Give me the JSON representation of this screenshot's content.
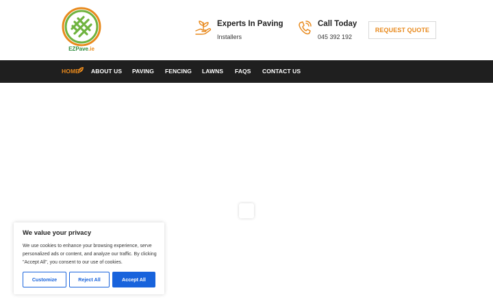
{
  "brand": {
    "name": "EZPave",
    "suffix": ".ie",
    "accent": "#e8891c",
    "green": "#2a8a3a"
  },
  "header": {
    "experts_title": "Experts In Paving",
    "experts_sub": "Installers",
    "call_title": "Call Today",
    "call_phone": "045 392 192",
    "quote_label": "REQUEST QUOTE"
  },
  "nav": {
    "items": [
      {
        "label": "HOME",
        "active": true
      },
      {
        "label": "ABOUT US"
      },
      {
        "label": "PAVING"
      },
      {
        "label": "FENCING"
      },
      {
        "label": "LAWNS"
      },
      {
        "label": "FAQS"
      },
      {
        "label": "CONTACT US"
      }
    ]
  },
  "cookie": {
    "title": "We value your privacy",
    "text": "We use cookies to enhance your browsing experience, serve personalized ads or content, and analyze our traffic. By clicking \"Accept All\", you consent to our use of cookies.",
    "customize": "Customize",
    "reject": "Reject All",
    "accept": "Accept All",
    "button_color": "#1863dc"
  },
  "icons": {
    "experts": "plant-hand-icon",
    "call": "phone-icon",
    "nav_leaf": "leaf-icon",
    "loader": "loading-spinner-icon"
  }
}
